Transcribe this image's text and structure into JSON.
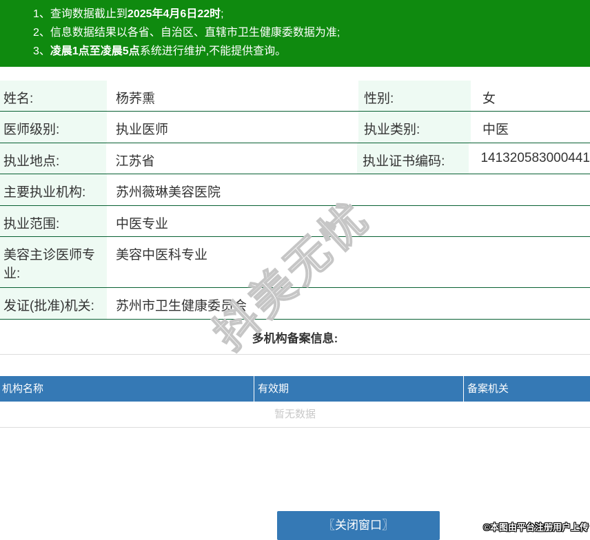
{
  "banner": {
    "notices": [
      {
        "num": "1、",
        "pre": "查询数据截止到",
        "bold": "2025年4月6日22时",
        "post": ";"
      },
      {
        "num": "2、",
        "pre": "信息数据结果以各省、自治区、直辖市卫生健康委数据为准;",
        "bold": "",
        "post": ""
      },
      {
        "num": "3、",
        "pre": "",
        "bold": "凌晨1点至凌晨5点",
        "post": "系统进行维护,不能提供查询。"
      }
    ]
  },
  "info": {
    "rows": [
      {
        "cells": [
          {
            "label": "姓名:",
            "value": "杨荞熏"
          },
          {
            "label": "性别:",
            "value": "女"
          }
        ]
      },
      {
        "cells": [
          {
            "label": "医师级别:",
            "value": "执业医师"
          },
          {
            "label": "执业类别:",
            "value": "中医"
          }
        ]
      },
      {
        "cells": [
          {
            "label": "执业地点:",
            "value": "江苏省"
          },
          {
            "label": "执业证书编码:",
            "value": "141320583000441"
          }
        ]
      },
      {
        "cells": [
          {
            "label": "主要执业机构:",
            "value": "苏州薇琳美容医院"
          }
        ]
      },
      {
        "cells": [
          {
            "label": "执业范围:",
            "value": "中医专业"
          }
        ]
      },
      {
        "cells": [
          {
            "label": "美容主诊医师专业:",
            "value": "美容中医科专业"
          }
        ]
      },
      {
        "cells": [
          {
            "label": "发证(批准)机关:",
            "value": "苏州市卫生健康委员会"
          }
        ]
      }
    ]
  },
  "filing": {
    "title": "多机构备案信息:",
    "columns": [
      "机构名称",
      "有效期",
      "备案机关"
    ],
    "empty_text": "暂无数据"
  },
  "footer": {
    "close_button": "〖关闭窗口〗",
    "copyright": "©本图由平台注册用户上传"
  },
  "watermark": "抖美无忧",
  "colors": {
    "banner_green": "#0f8a0f",
    "row_border_green": "#065f31",
    "label_mint": "#eefaf3",
    "header_blue": "#3579b5",
    "empty_text_gray": "#c9c9c9"
  }
}
